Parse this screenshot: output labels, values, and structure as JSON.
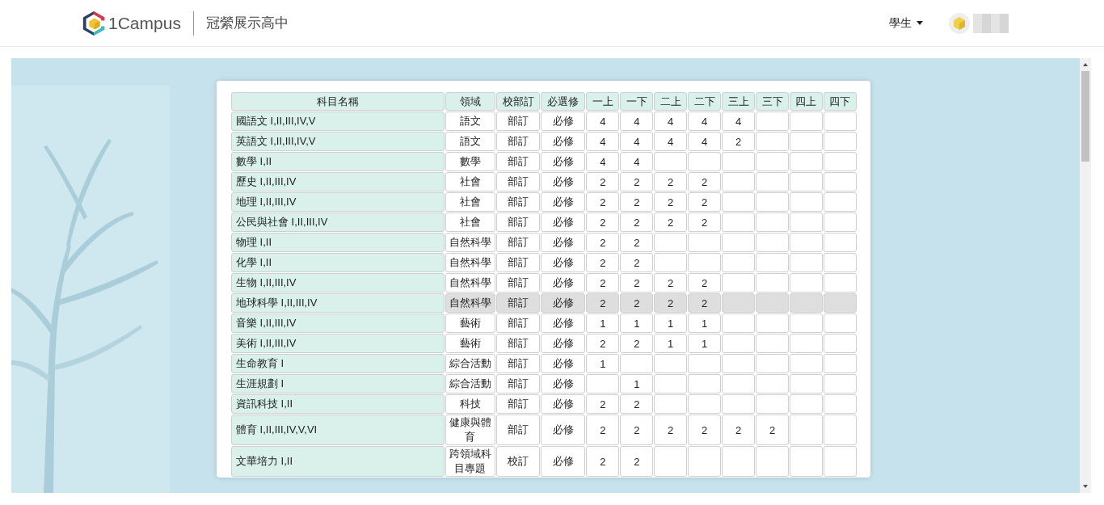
{
  "header": {
    "brand": "1Campus",
    "school": "冠縈展示高中",
    "role_menu": "學生"
  },
  "table": {
    "columns": [
      "科目名稱",
      "領域",
      "校部訂",
      "必選修",
      "一上",
      "一下",
      "二上",
      "二下",
      "三上",
      "三下",
      "四上",
      "四下"
    ],
    "rows": [
      {
        "subject": "國語文 I,II,III,IV,V",
        "domain": "語文",
        "type": "部訂",
        "required": "必修",
        "credits": [
          {
            "kind": "credit",
            "text": "4"
          },
          {
            "kind": "credit",
            "text": "4"
          },
          {
            "kind": "credit",
            "text": "4"
          },
          {
            "kind": "credit",
            "text": "4"
          },
          {
            "kind": "credit",
            "text": "4"
          }
        ],
        "selected": false
      },
      {
        "subject": "英語文 I,II,III,IV,V",
        "domain": "語文",
        "type": "部訂",
        "required": "必修",
        "credits": [
          {
            "kind": "credit",
            "text": "4"
          },
          {
            "kind": "credit",
            "text": "4"
          },
          {
            "kind": "credit",
            "text": "4"
          },
          {
            "kind": "credit",
            "text": "4"
          },
          {
            "kind": "credit",
            "text": "2"
          }
        ],
        "selected": false
      },
      {
        "subject": "數學 I,II",
        "domain": "數學",
        "type": "部訂",
        "required": "必修",
        "credits": [
          {
            "kind": "credit",
            "text": "4"
          },
          {
            "kind": "credit",
            "text": "4"
          }
        ],
        "selected": false
      },
      {
        "subject": "歷史 I,II,III,IV",
        "domain": "社會",
        "type": "部訂",
        "required": "必修",
        "credits": [
          {
            "kind": "credit",
            "text": "2"
          },
          {
            "kind": "credit",
            "text": "2"
          },
          {
            "kind": "credit",
            "text": "2"
          },
          {
            "kind": "credit",
            "text": "2"
          }
        ],
        "selected": false
      },
      {
        "subject": "地理 I,II,III,IV",
        "domain": "社會",
        "type": "部訂",
        "required": "必修",
        "credits": [
          {
            "kind": "credit",
            "text": "2"
          },
          {
            "kind": "credit",
            "text": "2"
          },
          {
            "kind": "credit",
            "text": "2"
          },
          {
            "kind": "credit",
            "text": "2"
          }
        ],
        "selected": false
      },
      {
        "subject": "公民與社會 I,II,III,IV",
        "domain": "社會",
        "type": "部訂",
        "required": "必修",
        "credits": [
          {
            "kind": "credit",
            "text": "2"
          },
          {
            "kind": "credit",
            "text": "2"
          },
          {
            "kind": "credit",
            "text": "2"
          },
          {
            "kind": "credit",
            "text": "2"
          }
        ],
        "selected": false
      },
      {
        "subject": "物理 I,II",
        "domain": "自然科學",
        "type": "部訂",
        "required": "必修",
        "credits": [
          {
            "kind": "credit",
            "text": "2"
          },
          {
            "kind": "credit",
            "text": "2"
          }
        ],
        "selected": false
      },
      {
        "subject": "化學 I,II",
        "domain": "自然科學",
        "type": "部訂",
        "required": "必修",
        "credits": [
          {
            "kind": "credit",
            "text": "2"
          },
          {
            "kind": "credit",
            "text": "2"
          }
        ],
        "selected": false
      },
      {
        "subject": "生物 I,II,III,IV",
        "domain": "自然科學",
        "type": "部訂",
        "required": "必修",
        "credits": [
          {
            "kind": "credit",
            "text": "2"
          },
          {
            "kind": "credit",
            "text": "2"
          },
          {
            "kind": "credit",
            "text": "2"
          },
          {
            "kind": "credit",
            "text": "2"
          }
        ],
        "selected": false
      },
      {
        "subject": "地球科學 I,II,III,IV",
        "domain": "自然科學",
        "type": "部訂",
        "required": "必修",
        "credits": [
          {
            "kind": "credit",
            "text": "2"
          },
          {
            "kind": "credit",
            "text": "2"
          },
          {
            "kind": "credit",
            "text": "2"
          },
          {
            "kind": "credit",
            "text": "2"
          }
        ],
        "selected": true
      },
      {
        "subject": "音樂 I,II,III,IV",
        "domain": "藝術",
        "type": "部訂",
        "required": "必修",
        "credits": [
          {
            "kind": "credit",
            "text": "1"
          },
          {
            "kind": "credit",
            "text": "1"
          },
          {
            "kind": "credit",
            "text": "1"
          },
          {
            "kind": "credit",
            "text": "1"
          }
        ],
        "selected": false
      },
      {
        "subject": "美術 I,II,III,IV",
        "domain": "藝術",
        "type": "部訂",
        "required": "必修",
        "credits": [
          {
            "kind": "credit",
            "text": "2"
          },
          {
            "kind": "credit",
            "text": "2"
          },
          {
            "kind": "credit",
            "text": "1"
          },
          {
            "kind": "credit",
            "text": "1"
          }
        ],
        "selected": false
      },
      {
        "subject": "生命教育 I",
        "domain": "綜合活動",
        "type": "部訂",
        "required": "必修",
        "credits": [
          {
            "kind": "credit",
            "text": "1"
          }
        ],
        "selected": false
      },
      {
        "subject": "生涯規劃 I",
        "domain": "綜合活動",
        "type": "部訂",
        "required": "必修",
        "credits": [
          {
            "kind": "blank"
          },
          {
            "kind": "credit",
            "text": "1"
          }
        ],
        "selected": false
      },
      {
        "subject": "資訊科技 I,II",
        "domain": "科技",
        "type": "部訂",
        "required": "必修",
        "credits": [
          {
            "kind": "credit",
            "text": "2"
          },
          {
            "kind": "credit",
            "text": "2"
          }
        ],
        "selected": false
      },
      {
        "subject": "體育 I,II,III,IV,V,VI",
        "domain": "健康與體育",
        "type": "部訂",
        "required": "必修",
        "credits": [
          {
            "kind": "credit",
            "text": "2"
          },
          {
            "kind": "credit",
            "text": "2"
          },
          {
            "kind": "credit",
            "text": "2"
          },
          {
            "kind": "credit",
            "text": "2"
          },
          {
            "kind": "credit",
            "text": "2"
          },
          {
            "kind": "credit",
            "text": "2"
          }
        ],
        "selected": false
      },
      {
        "subject": "文華培力 I,II",
        "domain": "跨領域科目專題",
        "type": "校訂",
        "required": "必修",
        "credits": [
          {
            "kind": "credit",
            "text": "2"
          },
          {
            "kind": "credit",
            "text": "2"
          }
        ],
        "selected": false
      }
    ]
  }
}
